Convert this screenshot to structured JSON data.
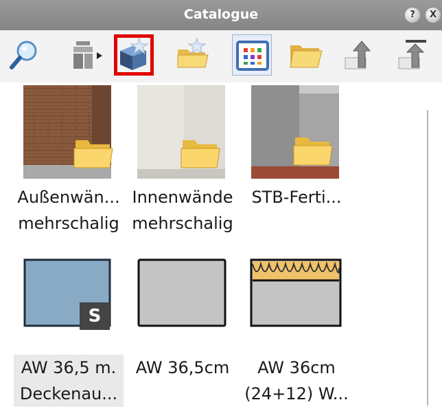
{
  "window": {
    "title": "Catalogue",
    "help_label": "?",
    "close_label": "X"
  },
  "toolbar": {
    "tools": [
      {
        "name": "search-icon"
      },
      {
        "name": "transfer-icon"
      },
      {
        "name": "new-smart-part-icon",
        "highlighted": true
      },
      {
        "name": "new-folder-star-icon"
      },
      {
        "name": "view-palette-icon",
        "pressed": true
      },
      {
        "name": "open-folder-icon"
      },
      {
        "name": "up-arrow-icon"
      },
      {
        "name": "up-top-arrow-icon"
      }
    ]
  },
  "catalog": {
    "items": [
      {
        "name": "item-aussenwaende",
        "label": "Außenwän...\nmehrschalig",
        "thumb": "brick-wall-folder"
      },
      {
        "name": "item-innenwaende",
        "label": "Innenwände\nmehrschalig",
        "thumb": "plaster-wall-folder"
      },
      {
        "name": "item-stb-fertig",
        "label": "STB-Ferti...",
        "thumb": "concrete-wall-folder"
      },
      {
        "name": "item-aw-36-5-m",
        "label": "AW 36,5 m.\nDeckenau...",
        "thumb": "blue-rect-s",
        "badge": "S",
        "selected": true
      },
      {
        "name": "item-aw-36-5cm",
        "label": "AW 36,5cm",
        "thumb": "grey-rect"
      },
      {
        "name": "item-aw-36cm",
        "label": "AW 36cm\n(24+12) W...",
        "thumb": "insulation-rect"
      }
    ]
  }
}
